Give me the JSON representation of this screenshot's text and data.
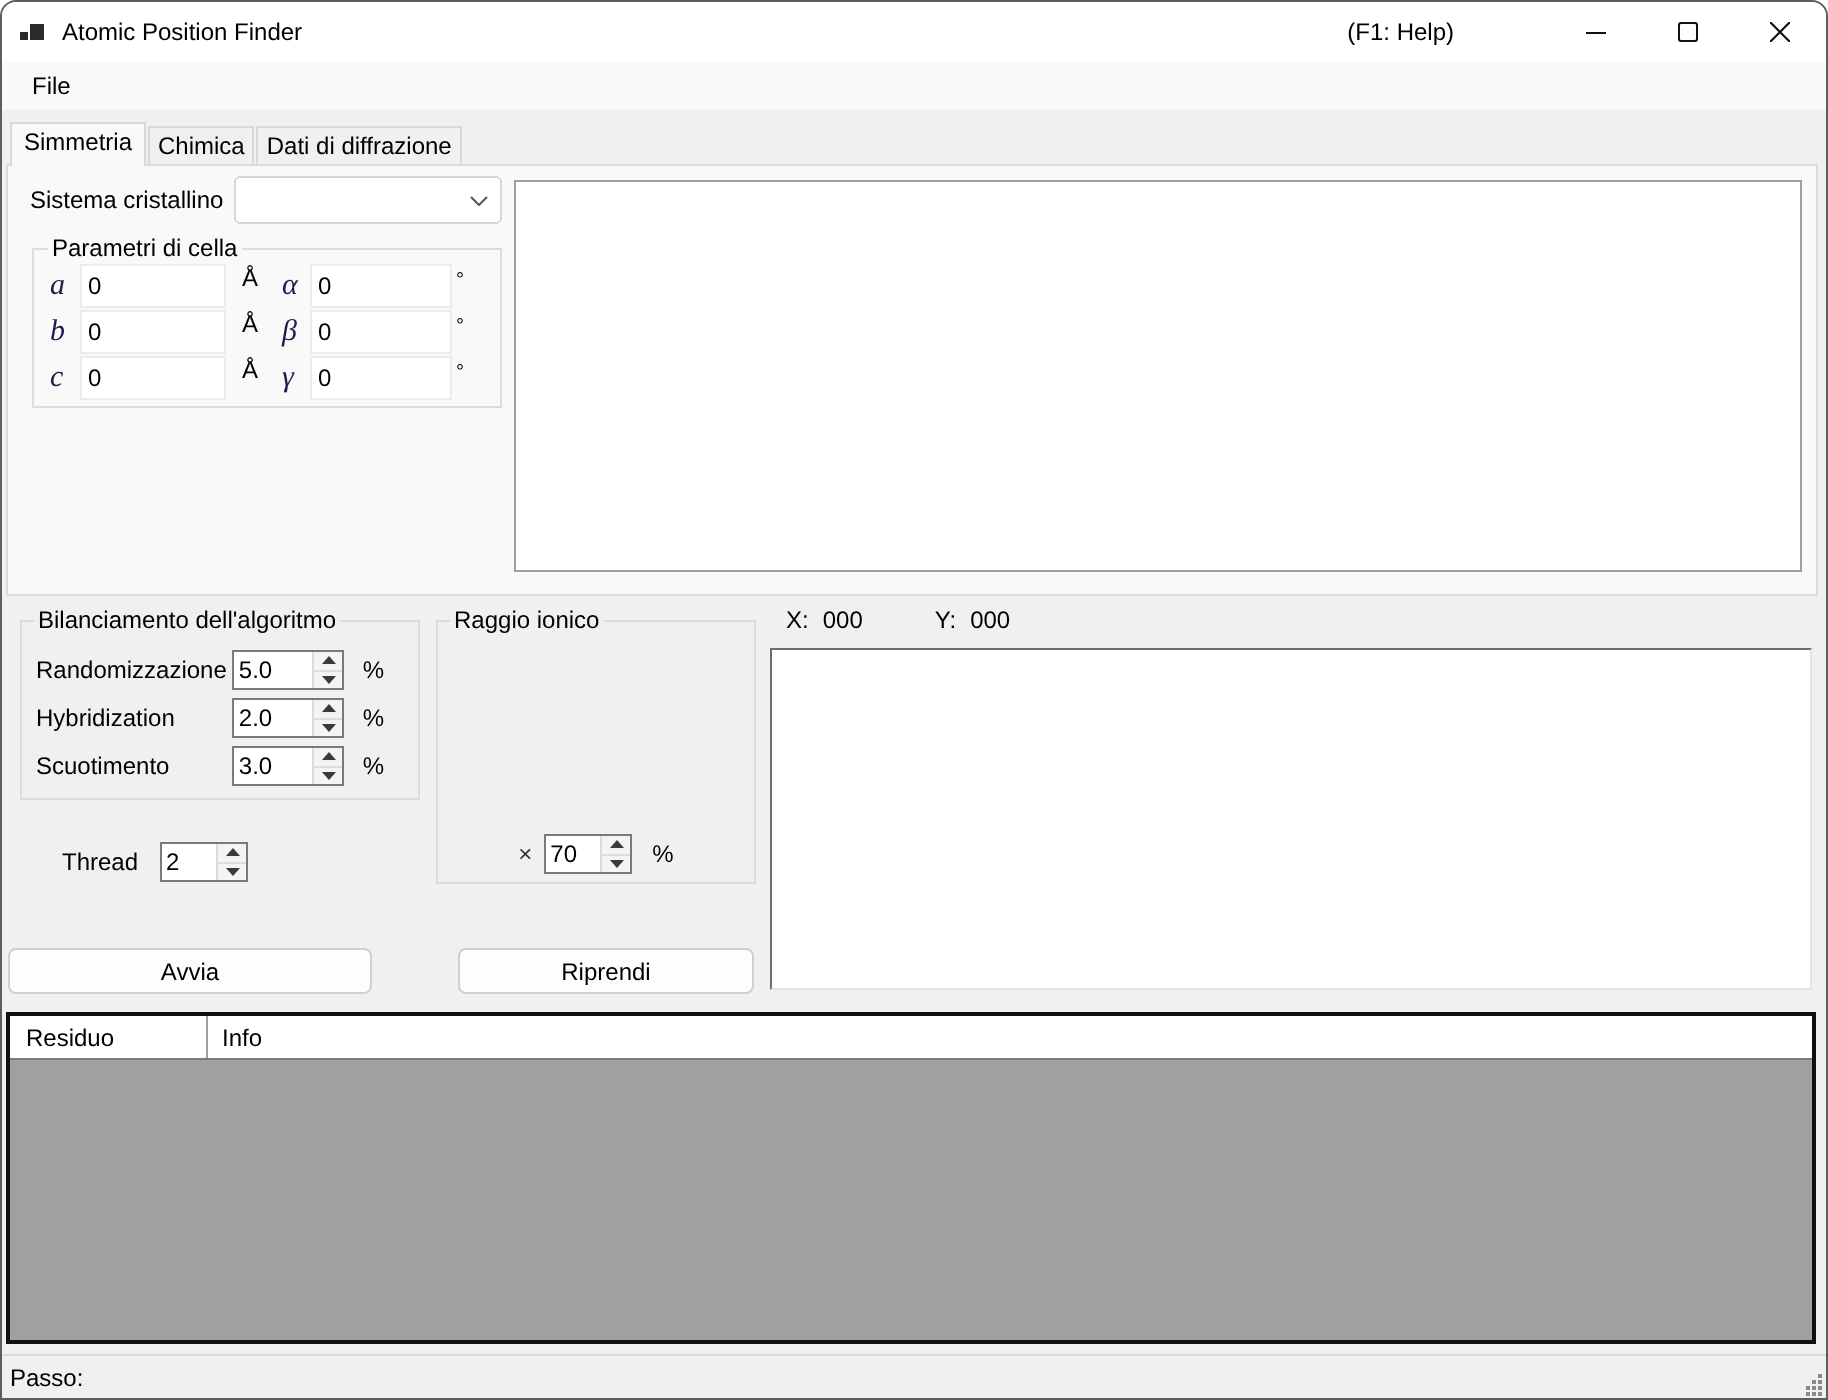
{
  "window": {
    "title": "Atomic Position Finder",
    "help_hint": "(F1: Help)"
  },
  "menu": [
    {
      "label": "File"
    }
  ],
  "tabs": [
    {
      "label": "Simmetria",
      "selected": true
    },
    {
      "label": "Chimica",
      "selected": false
    },
    {
      "label": "Dati di diffrazione",
      "selected": false
    }
  ],
  "symmetry": {
    "crystal_system": {
      "label": "Sistema cristallino"
    },
    "cell_parameters": {
      "title": "Parametri di cella",
      "lengths": [
        {
          "symbol": "a",
          "value": "0",
          "unit": "Å"
        },
        {
          "symbol": "b",
          "value": "0",
          "unit": "Å"
        },
        {
          "symbol": "c",
          "value": "0",
          "unit": "Å"
        }
      ],
      "angles": [
        {
          "symbol": "α",
          "value": "0",
          "unit": "°"
        },
        {
          "symbol": "β",
          "value": "0",
          "unit": "°"
        },
        {
          "symbol": "γ",
          "value": "0",
          "unit": "°"
        }
      ]
    }
  },
  "balancing": {
    "title": "Bilanciamento dell'algoritmo",
    "parameters": [
      {
        "label": "Randomizzazione",
        "value": "5.0",
        "unit": "%"
      },
      {
        "label": "Hybridization",
        "value": "2.0",
        "unit": "%"
      },
      {
        "label": "Scuotimento",
        "value": "3.0",
        "unit": "%"
      }
    ]
  },
  "thread": {
    "label": "Thread",
    "value": "2"
  },
  "ionic_radius": {
    "title": "Raggio ionico",
    "prefix": "×",
    "value": "70",
    "unit": "%"
  },
  "coordinates": [
    {
      "label": "X:",
      "value": "000"
    },
    {
      "label": "Y:",
      "value": "000"
    }
  ],
  "buttons": [
    {
      "label": "Avvia"
    },
    {
      "label": "Riprendi"
    }
  ],
  "table": {
    "columns": [
      "Residuo",
      "Info"
    ]
  },
  "status_bar": {
    "label": "Passo:"
  }
}
